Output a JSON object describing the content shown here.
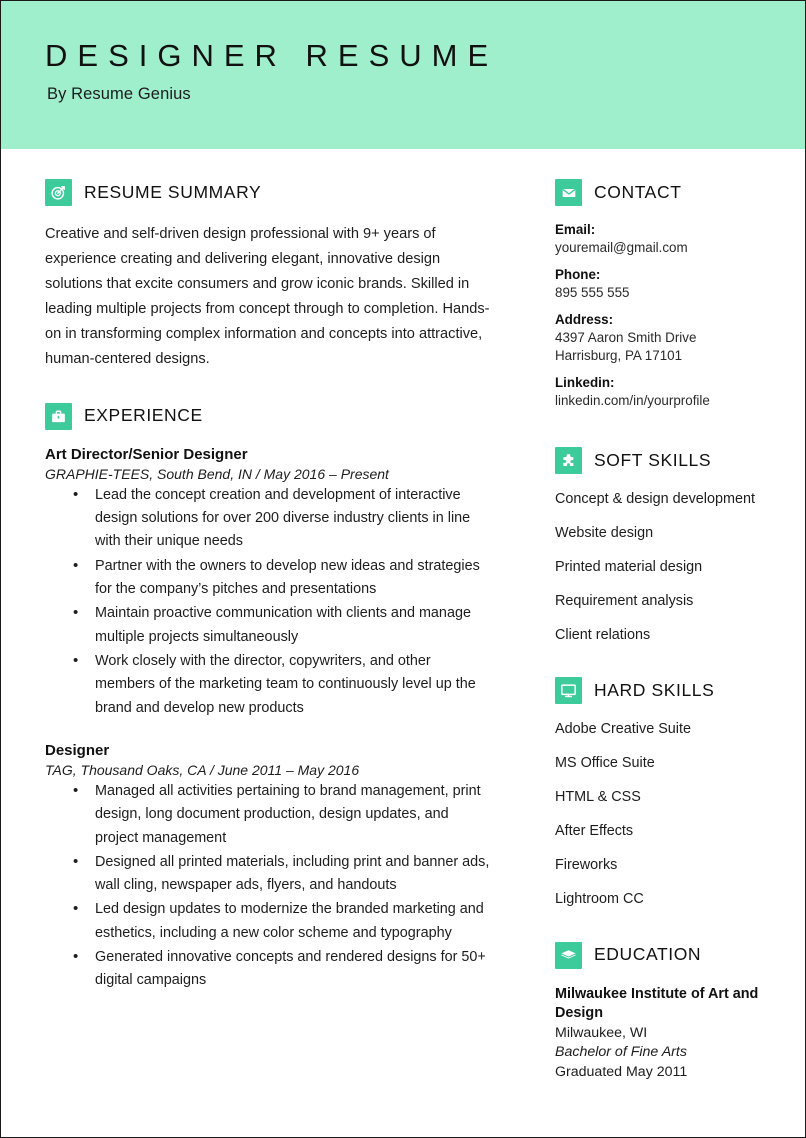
{
  "header": {
    "title": "DESIGNER RESUME",
    "subtitle": "By Resume Genius",
    "band_color": "#9FEFCD"
  },
  "theme": {
    "accent": "#3DCB9B",
    "band": "#9FEFCD",
    "text": "#1d1d1d"
  },
  "summary": {
    "icon": "target-icon",
    "heading": "RESUME SUMMARY",
    "text": "Creative and self-driven design professional with 9+ years of experience creating and delivering elegant, innovative design solutions that excite consumers and grow iconic brands. Skilled in leading multiple projects from concept through to completion. Hands-on in transforming complex information and concepts into attractive, human-centered designs."
  },
  "experience": {
    "icon": "briefcase-icon",
    "heading": "EXPERIENCE",
    "jobs": [
      {
        "title": "Art Director/Senior Designer",
        "meta": "GRAPHIE-TEES, South Bend, IN /  May 2016 – Present",
        "bullets": [
          "Lead the concept creation and development of interactive design solutions for over 200 diverse industry clients in line with their unique needs",
          "Partner with the owners to develop new ideas and strategies for the company’s pitches and presentations",
          "Maintain proactive communication with clients and manage multiple projects simultaneously",
          "Work closely with the director, copywriters, and other members of the marketing team to continuously level up the brand and develop new products"
        ]
      },
      {
        "title": "Designer",
        "meta": "TAG, Thousand Oaks, CA  /  June 2011 – May 2016",
        "bullets": [
          "Managed all activities pertaining to brand management, print design, long document production, design updates, and project management",
          "Designed all printed materials, including print and banner ads, wall cling, newspaper ads, flyers, and handouts",
          "Led design updates to modernize the branded marketing and esthetics, including a new color scheme and typography",
          "Generated innovative concepts and rendered designs for 50+ digital campaigns"
        ]
      }
    ]
  },
  "contact": {
    "icon": "envelope-icon",
    "heading": "CONTACT",
    "entries": [
      {
        "label": "Email:",
        "value": "youremail@gmail.com"
      },
      {
        "label": "Phone:",
        "value": "895 555 555"
      },
      {
        "label": "Address:",
        "value": "4397 Aaron Smith Drive\nHarrisburg, PA 17101"
      },
      {
        "label": "Linkedin:",
        "value": "linkedin.com/in/yourprofile"
      }
    ]
  },
  "soft_skills": {
    "icon": "puzzle-icon",
    "heading": "SOFT SKILLS",
    "items": [
      "Concept & design development",
      "Website design",
      "Printed material design",
      "Requirement analysis",
      "Client relations"
    ]
  },
  "hard_skills": {
    "icon": "monitor-icon",
    "heading": "HARD SKILLS",
    "items": [
      "Adobe Creative Suite",
      "MS Office Suite",
      "HTML & CSS",
      "After Effects",
      "Fireworks",
      "Lightroom CC"
    ]
  },
  "education": {
    "icon": "graduation-cap-icon",
    "heading": "EDUCATION",
    "school": "Milwaukee Institute of Art and Design",
    "location": "Milwaukee, WI",
    "degree": "Bachelor of Fine Arts",
    "graduated": "Graduated May 2011"
  }
}
